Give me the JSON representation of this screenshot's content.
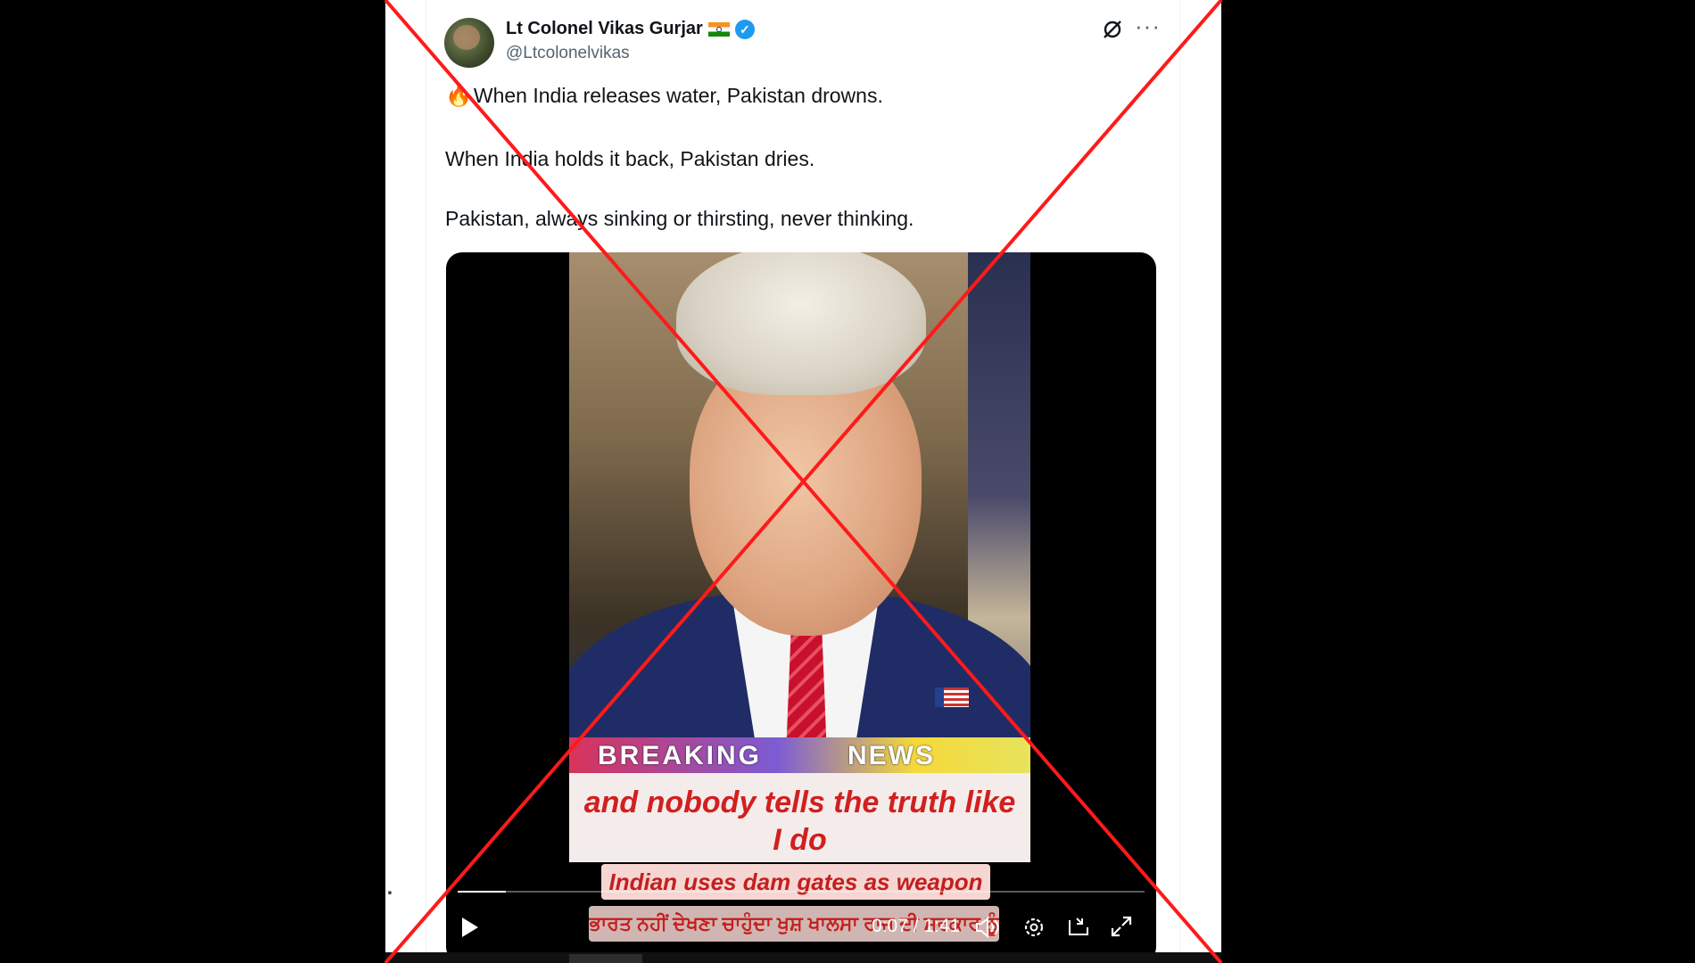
{
  "tweet": {
    "author_name": "Lt Colonel Vikas Gurjar",
    "handle": "@Ltcolonelvikas",
    "flag_icon": "india-flag-icon",
    "verified_icon": "verified-badge-icon",
    "more_label": "···",
    "lines": [
      "When India releases water, Pakistan drowns.",
      "When India holds it back, Pakistan dries.",
      "Pakistan, always sinking or thirsting, never thinking."
    ],
    "lead_emoji": "🔥"
  },
  "video": {
    "banner_breaking": "BREAKING",
    "banner_news": "NEWS",
    "caption_line1": "and nobody tells the truth like",
    "caption_line2": "I do",
    "subtitle_english": "Indian uses dam gates as weapon",
    "subtitle_punjabi": "ਭਾਰਤ ਨਹੀਂ ਦੇਖਣਾ ਚਾਹੁੰਦਾ ਖੁਸ਼ ਖਾਲਸਾ ਰਾਜ ਦੀ ਸਰਕਾਰ ਨੂੰ",
    "time_display": "0:07 / 1:41",
    "progress_fraction": 0.07
  },
  "colors": {
    "x_overlay": "#ff0000",
    "verified": "#1d9bf0",
    "caption_red": "#d21f1f"
  }
}
